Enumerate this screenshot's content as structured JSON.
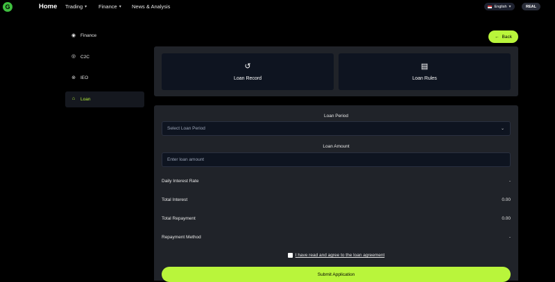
{
  "header": {
    "logo_letter": "G",
    "home": "Home",
    "trading": "Trading",
    "finance": "Finance",
    "news": "News & Analysis",
    "language": "English",
    "account_mode": "REAL"
  },
  "sidebar": {
    "items": [
      {
        "label": "Finance",
        "icon": "finance-icon"
      },
      {
        "label": "C2C",
        "icon": "c2c-icon"
      },
      {
        "label": "IEO",
        "icon": "ieo-icon"
      },
      {
        "label": "Loan",
        "icon": "bank-icon",
        "active": true
      }
    ]
  },
  "back_label": "Back",
  "cards": {
    "record": "Loan Record",
    "rules": "Loan Rules"
  },
  "form": {
    "period_label": "Loan Period",
    "period_placeholder": "Select Loan Period",
    "amount_label": "Loan Amount",
    "amount_placeholder": "Enter loan amount",
    "rows": [
      {
        "label": "Daily Interest Rate",
        "value": "-"
      },
      {
        "label": "Total Interest",
        "value": "0.00"
      },
      {
        "label": "Total Repayment",
        "value": "0.00"
      },
      {
        "label": "Repayment Method",
        "value": "-"
      }
    ],
    "agree_text": "I have read and agree to the loan agreement",
    "submit": "Submit Application"
  },
  "colors": {
    "accent": "#b9f53b",
    "panel": "#202329",
    "field": "#0e1420"
  }
}
